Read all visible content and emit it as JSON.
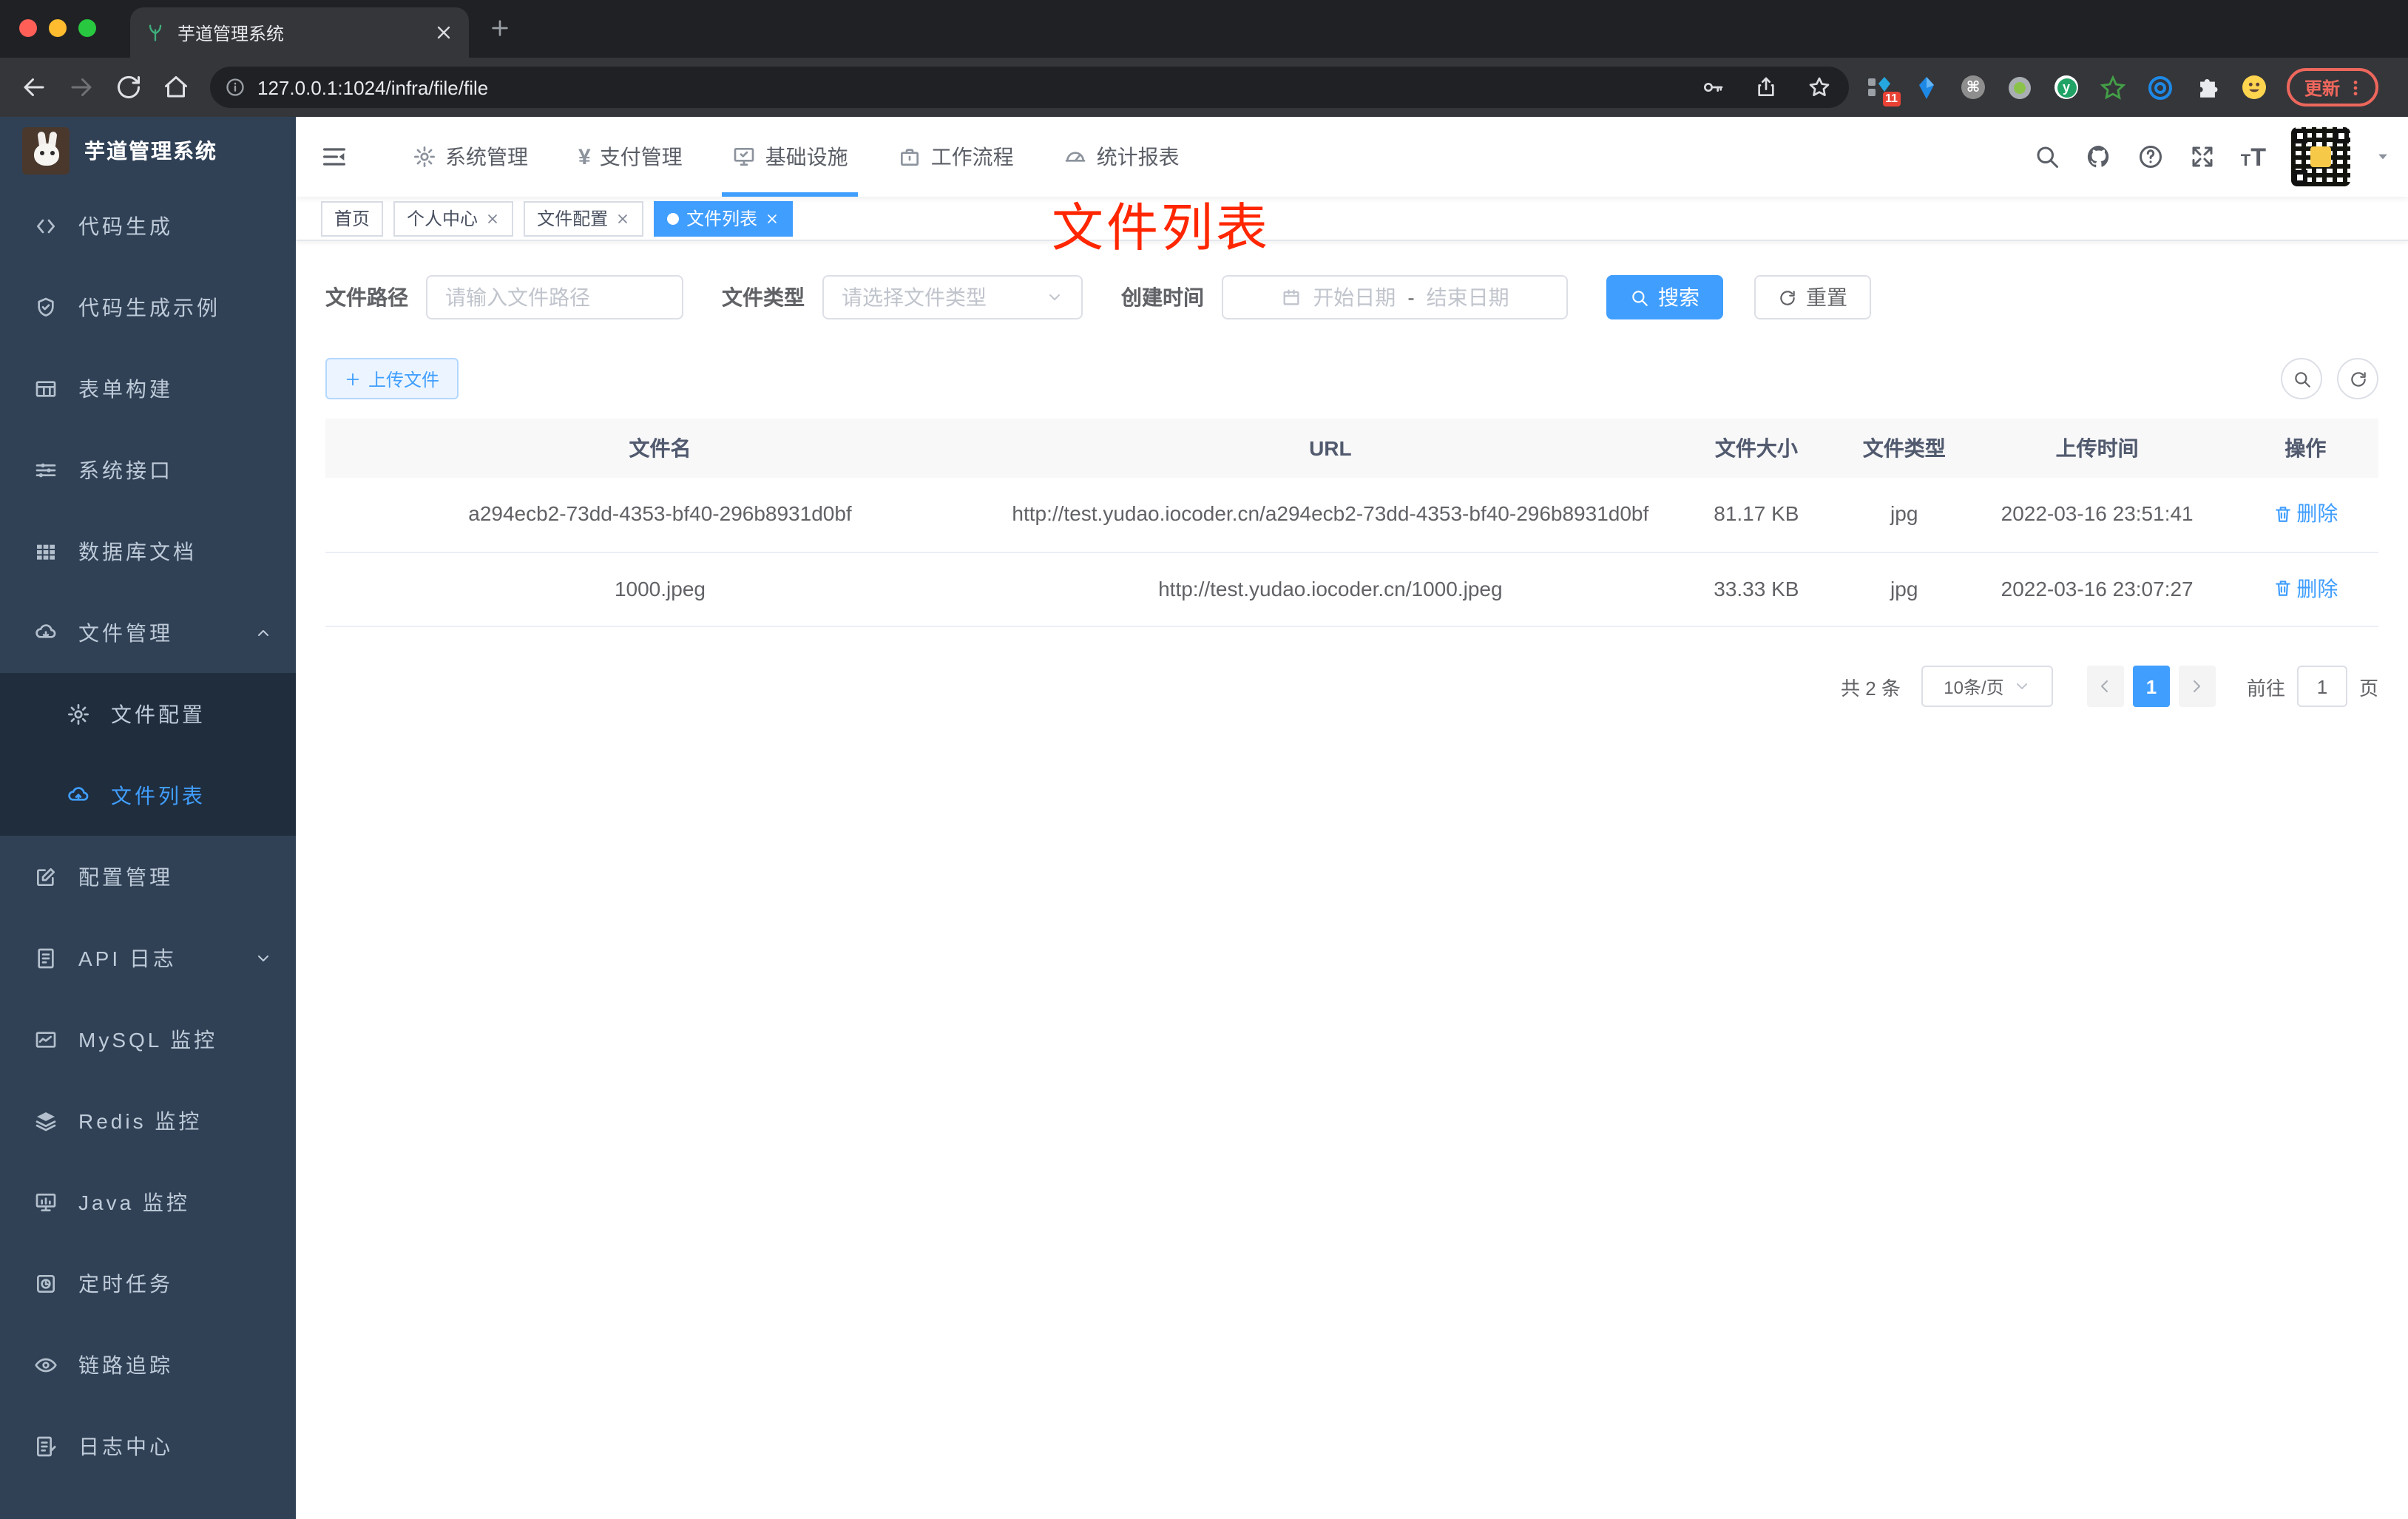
{
  "browser": {
    "tab_title": "芋道管理系统",
    "url": "127.0.0.1:1024/infra/file/file",
    "extension_badge": "11",
    "cmd_glyph": "⌘",
    "y_glyph": "y",
    "update_label": "更新"
  },
  "app": {
    "logo_title": "芋道管理系统",
    "annotation": "文件列表",
    "top_menu": [
      {
        "label": "系统管理"
      },
      {
        "label": "支付管理",
        "glyph": "¥"
      },
      {
        "label": "基础设施",
        "active": true
      },
      {
        "label": "工作流程"
      },
      {
        "label": "统计报表"
      }
    ],
    "sidebar": [
      {
        "label": "代码生成"
      },
      {
        "label": "代码生成示例"
      },
      {
        "label": "表单构建"
      },
      {
        "label": "系统接口"
      },
      {
        "label": "数据库文档"
      },
      {
        "label": "文件管理"
      },
      {
        "label": "文件配置"
      },
      {
        "label": "文件列表"
      },
      {
        "label": "配置管理"
      },
      {
        "label": "API 日志"
      },
      {
        "label": "MySQL 监控"
      },
      {
        "label": "Redis 监控"
      },
      {
        "label": "Java 监控"
      },
      {
        "label": "定时任务"
      },
      {
        "label": "链路追踪"
      },
      {
        "label": "日志中心"
      }
    ],
    "tags": [
      {
        "label": "首页"
      },
      {
        "label": "个人中心"
      },
      {
        "label": "文件配置"
      },
      {
        "label": "文件列表",
        "active": true
      }
    ]
  },
  "filters": {
    "path_label": "文件路径",
    "path_placeholder": "请输入文件路径",
    "type_label": "文件类型",
    "type_placeholder": "请选择文件类型",
    "time_label": "创建时间",
    "start_placeholder": "开始日期",
    "separator": "-",
    "end_placeholder": "结束日期",
    "search_label": "搜索",
    "reset_label": "重置"
  },
  "toolbar": {
    "upload_label": "上传文件"
  },
  "table": {
    "headers": [
      "文件名",
      "URL",
      "文件大小",
      "文件类型",
      "上传时间",
      "操作"
    ],
    "rows": [
      {
        "name": "a294ecb2-73dd-4353-bf40-296b8931d0bf",
        "url": "http://test.yudao.iocoder.cn/a294ecb2-73dd-4353-bf40-296b8931d0bf",
        "size": "81.17 KB",
        "type": "jpg",
        "time": "2022-03-16 23:51:41",
        "action": "删除"
      },
      {
        "name": "1000.jpeg",
        "url": "http://test.yudao.iocoder.cn/1000.jpeg",
        "size": "33.33 KB",
        "type": "jpg",
        "time": "2022-03-16 23:07:27",
        "action": "删除"
      }
    ]
  },
  "pagination": {
    "total": "共 2 条",
    "page_size": "10条/页",
    "current": "1",
    "goto": "前往",
    "goto_value": "1",
    "unit": "页"
  },
  "colors": {
    "accent": "#409eff",
    "sidebar_bg": "#304156",
    "submenu_bg": "#1f2d3d",
    "annotation": "#ff2600",
    "update": "#ee675c"
  }
}
